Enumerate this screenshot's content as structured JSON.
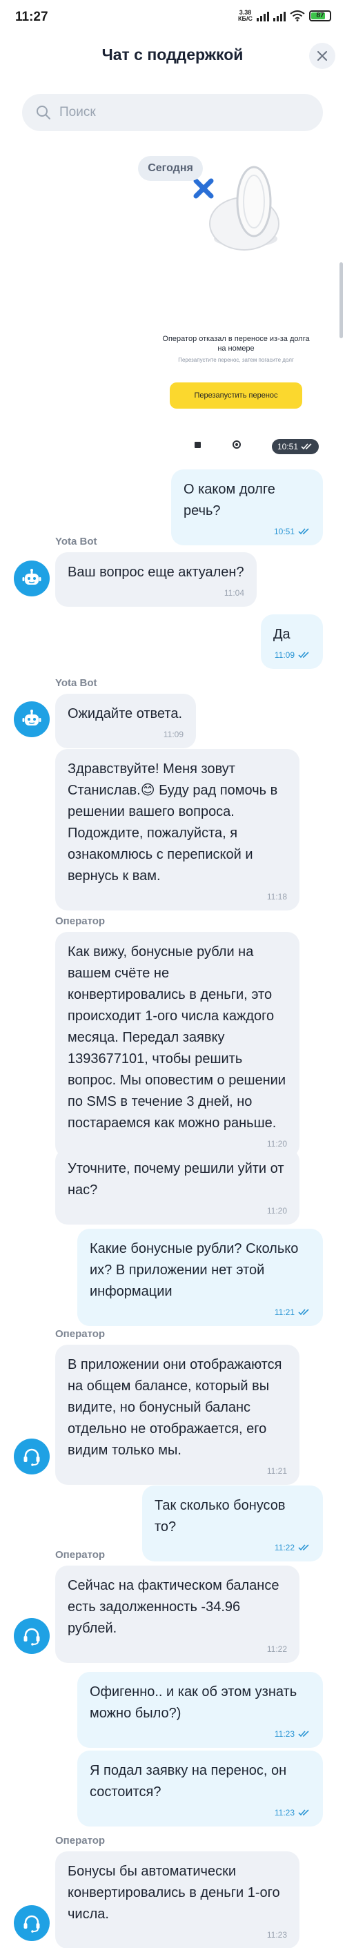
{
  "status_bar": {
    "time": "11:27",
    "speed_value": "3.38",
    "speed_unit": "КБ/С",
    "battery": "87"
  },
  "header": {
    "title": "Чат с поддержкой"
  },
  "search": {
    "placeholder": "Поиск"
  },
  "date_chip": "Сегодня",
  "image_message": {
    "error_title": "Оператор отказал в переносе из-за долга на номере",
    "error_subtitle": "Перезапустите перенос, затем погасите долг",
    "restart_button": "Перезапустить перенос",
    "time": "10:51"
  },
  "messages": [
    {
      "id": "m1",
      "direction": "out",
      "text": "О каком долге речь?",
      "time": "10:51"
    },
    {
      "id": "m2",
      "direction": "in",
      "sender": "Yota Bot",
      "avatar": "bot-icon",
      "text": "Ваш вопрос еще актуален?",
      "time": "11:04"
    },
    {
      "id": "m3",
      "direction": "out",
      "text": "Да",
      "time": "11:09"
    },
    {
      "id": "m4",
      "direction": "in",
      "sender": "Yota Bot",
      "avatar": "bot-icon",
      "text": "Ожидайте ответа.",
      "time": "11:09"
    },
    {
      "id": "m5",
      "direction": "in",
      "text": "Здравствуйте! Меня зовут Станислав.😊 Буду рад помочь в решении вашего вопроса. Подождите, пожалуйста, я ознакомлюсь с перепиской и вернусь к вам.",
      "time": "11:18"
    },
    {
      "id": "m6",
      "direction": "in",
      "sender": "Оператор",
      "avatar": "headset-icon",
      "text": "Как вижу, бонусные рубли на вашем счёте не конвертировались в деньги, это происходит 1-ого числа каждого месяца. Передал  заявку 1393677101, чтобы решить вопрос. Мы оповестим о решении по SMS в течение 3 дней, но постараемся как можно раньше.",
      "time": "11:20"
    },
    {
      "id": "m7",
      "direction": "in",
      "text": "Уточните, почему решили уйти от нас?",
      "time": "11:20"
    },
    {
      "id": "m8",
      "direction": "out",
      "text": "Какие бонусные рубли? Сколько их? В приложении нет этой информации",
      "time": "11:21"
    },
    {
      "id": "m9",
      "direction": "in",
      "sender": "Оператор",
      "avatar": "headset-icon",
      "text": "В приложении они отображаются на общем балансе, который вы видите, но бонусный баланс отдельно не отображается, его видим только мы.",
      "time": "11:21"
    },
    {
      "id": "m10",
      "direction": "out",
      "text": "Так сколько бонусов то?",
      "time": "11:22"
    },
    {
      "id": "m11",
      "direction": "in",
      "sender": "Оператор",
      "avatar": "headset-icon",
      "text": "Сейчас на фактическом балансе есть задолженность -34.96 рублей.",
      "time": "11:22"
    },
    {
      "id": "m12",
      "direction": "out",
      "text": "Офигенно.. и как об этом узнать можно было?)",
      "time": "11:23"
    },
    {
      "id": "m13",
      "direction": "out",
      "text": "Я подал заявку на перенос, он состоится?",
      "time": "11:23"
    },
    {
      "id": "m14",
      "direction": "in",
      "sender": "Оператор",
      "avatar": "headset-icon",
      "text": "Бонусы бы автоматически конвертировались в деньги 1-ого числа.",
      "time": "11:23"
    }
  ],
  "colors": {
    "accent": "#1fa1e4",
    "incoming_bubble": "#eef1f6",
    "outgoing_bubble": "#e9f6fd",
    "button_yellow": "#fbd82e"
  }
}
